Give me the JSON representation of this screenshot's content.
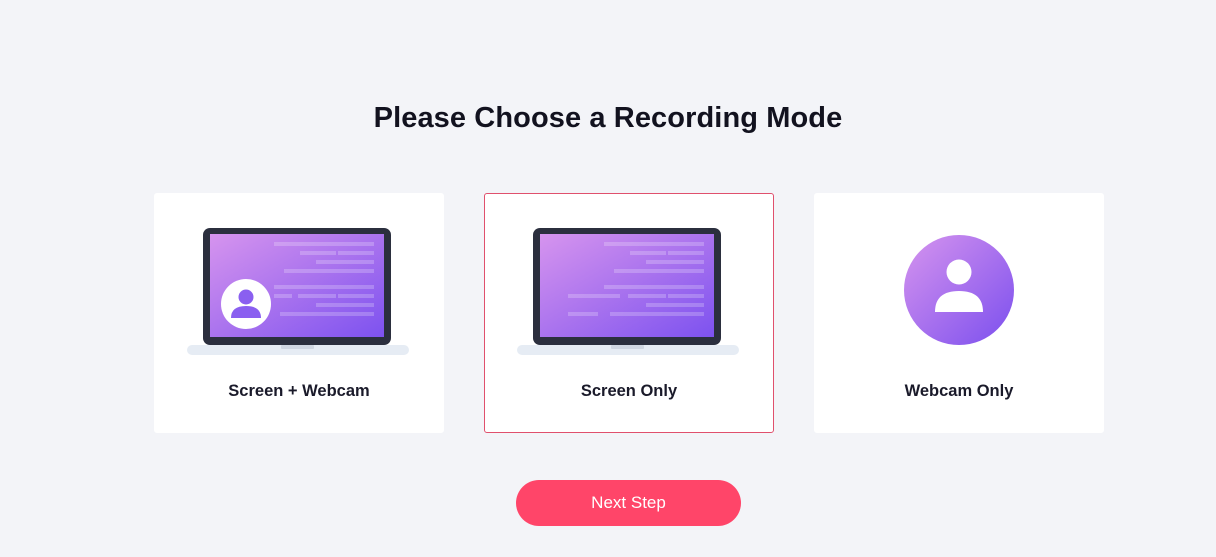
{
  "page": {
    "title": "Please Choose a Recording Mode"
  },
  "modes": [
    {
      "label": "Screen + Webcam",
      "icon": "laptop-webcam-icon",
      "selected": false
    },
    {
      "label": "Screen Only",
      "icon": "laptop-screen-icon",
      "selected": true
    },
    {
      "label": "Webcam Only",
      "icon": "webcam-user-icon",
      "selected": false
    }
  ],
  "actions": {
    "next_label": "Next Step"
  },
  "colors": {
    "background": "#f3f4f8",
    "accent": "#ff4569",
    "selected_border": "#e0506d",
    "gradient_start": "#d38ef0",
    "gradient_end": "#7b4fee"
  }
}
